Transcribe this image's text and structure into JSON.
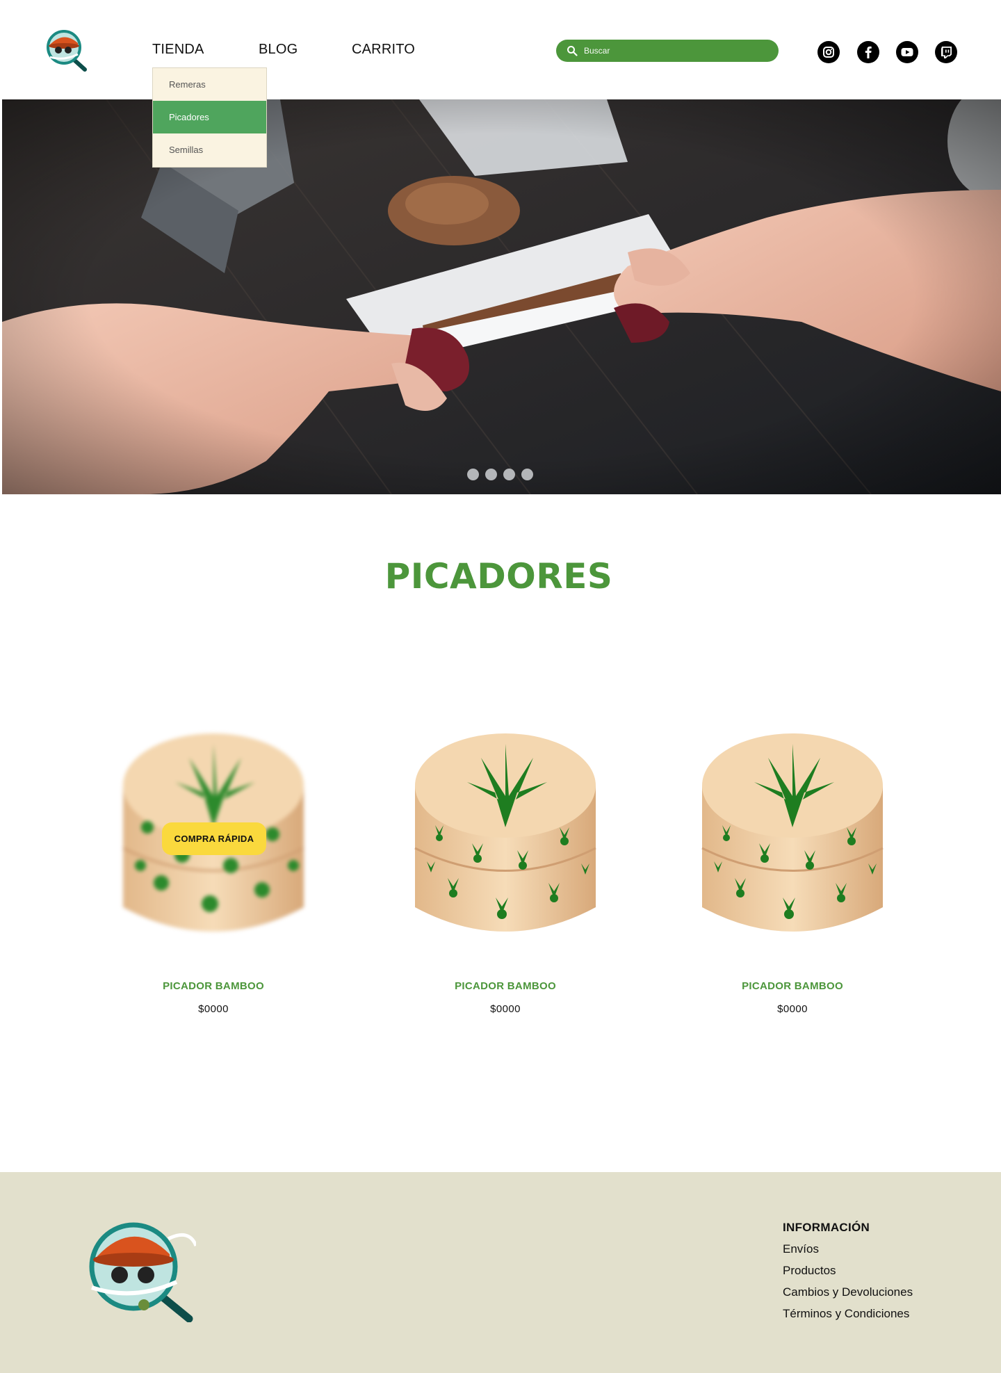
{
  "header": {
    "nav": {
      "tienda": "TIENDA",
      "blog": "BLOG",
      "carrito": "CARRITO"
    },
    "dropdown": [
      "Remeras",
      "Picadores",
      "Semillas"
    ],
    "dropdown_active": "Picadores",
    "search": {
      "placeholder": "Buscar"
    },
    "social": [
      "instagram-icon",
      "facebook-icon",
      "youtube-icon",
      "twitch-icon"
    ]
  },
  "hero": {
    "slide_count": 4,
    "active_slide": 1
  },
  "section": {
    "title": "PICADORES"
  },
  "products": [
    {
      "name": "PICADOR BAMBOO",
      "price": "$0000",
      "quick_buy": "COMPRA RÁPIDA"
    },
    {
      "name": "PICADOR BAMBOO",
      "price": "$0000"
    },
    {
      "name": "PICADOR BAMBOO",
      "price": "$0000"
    }
  ],
  "footer": {
    "info_title": "INFORMACIÓN",
    "links": [
      "Envíos",
      "Productos",
      "Cambios y Devoluciones",
      "Términos y Condiciones"
    ]
  },
  "colors": {
    "brand_green": "#4c963b",
    "dropdown_bg": "#faf3e1",
    "dropdown_active": "#4fa55d",
    "quick_buy": "#fad93d",
    "footer_bg": "#e2e0cc"
  }
}
